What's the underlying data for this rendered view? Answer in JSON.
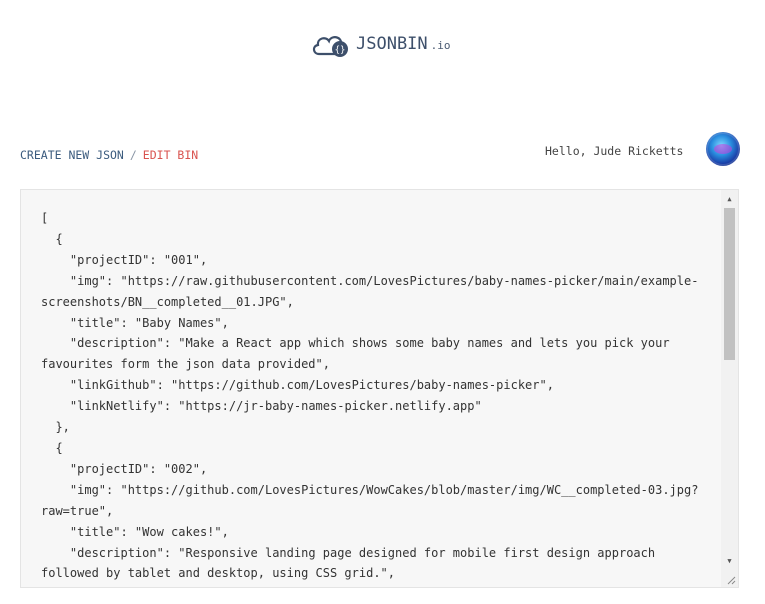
{
  "logo": {
    "name": "JSONBIN",
    "tld": ".io",
    "icon": "cloud-braces-icon"
  },
  "breadcrumb": {
    "create_label": "CREATE NEW JSON",
    "separator": "/",
    "current_label": "EDIT BIN"
  },
  "user": {
    "greeting": "Hello, Jude Ricketts"
  },
  "editor": {
    "content": "[\n  {\n    \"projectID\": \"001\",\n    \"img\": \"https://raw.githubusercontent.com/LovesPictures/baby-names-picker/main/example-screenshots/BN__completed__01.JPG\",\n    \"title\": \"Baby Names\",\n    \"description\": \"Make a React app which shows some baby names and lets you pick your favourites form the json data provided\",\n    \"linkGithub\": \"https://github.com/LovesPictures/baby-names-picker\",\n    \"linkNetlify\": \"https://jr-baby-names-picker.netlify.app\"\n  },\n  {\n    \"projectID\": \"002\",\n    \"img\": \"https://github.com/LovesPictures/WowCakes/blob/master/img/WC__completed-03.jpg?raw=true\",\n    \"title\": \"Wow cakes!\",\n    \"description\": \"Responsive landing page designed for mobile first design approach followed by tablet and desktop, using CSS grid.\","
  },
  "colors": {
    "link": "#3b5b7e",
    "active": "#d9534f",
    "brand": "#3d4f6a"
  }
}
